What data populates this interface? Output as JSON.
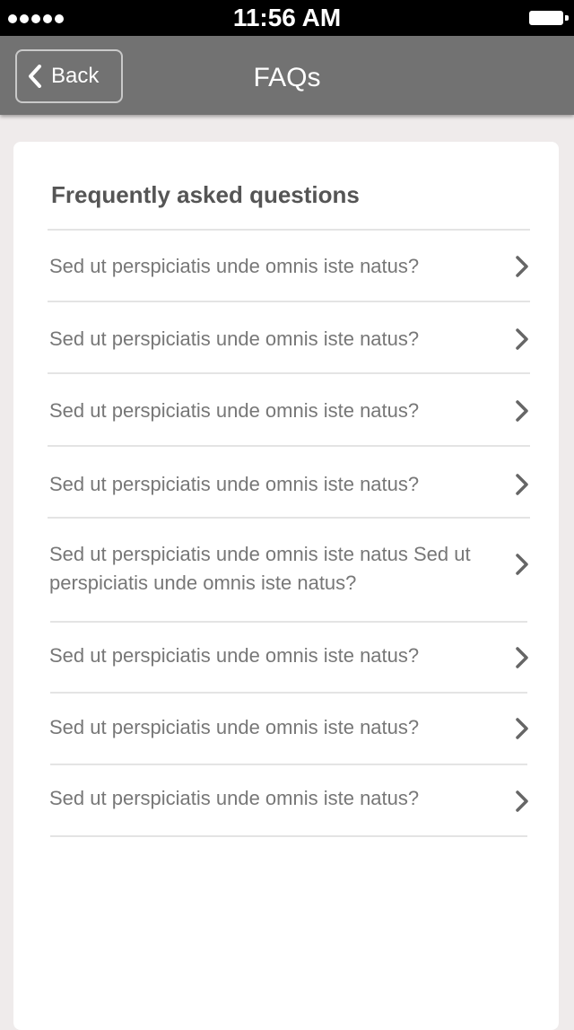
{
  "status_bar": {
    "time": "11:56 AM",
    "signal_icon": "signal-dots-icon",
    "battery_icon": "battery-icon"
  },
  "nav": {
    "back_label": "Back",
    "back_icon": "chevron-left-icon",
    "title": "FAQs"
  },
  "faq": {
    "title": "Frequently asked questions",
    "items": [
      {
        "question": "Sed ut perspiciatis unde omnis iste natus?"
      },
      {
        "question": "Sed ut perspiciatis unde omnis iste natus?"
      },
      {
        "question": "Sed ut perspiciatis unde omnis iste natus?"
      },
      {
        "question": "Sed ut perspiciatis unde omnis iste natus?"
      },
      {
        "question": "Sed ut perspiciatis unde omnis iste natus Sed ut perspiciatis unde omnis iste natus?"
      },
      {
        "question": "Sed ut perspiciatis unde omnis iste natus?"
      },
      {
        "question": "Sed ut perspiciatis unde omnis iste natus?"
      },
      {
        "question": "Sed ut perspiciatis unde omnis iste natus?"
      }
    ],
    "row_icon": "chevron-right-icon"
  },
  "colors": {
    "nav_background": "#727272",
    "page_background": "#efebeb",
    "text": "#777777",
    "divider": "#e4e4e4"
  }
}
